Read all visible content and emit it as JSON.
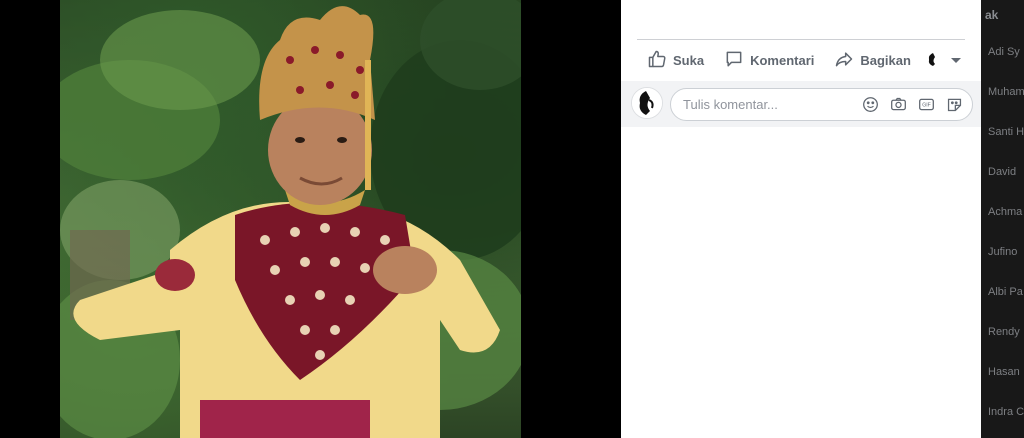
{
  "actions": {
    "like_label": "Suka",
    "comment_label": "Komentari",
    "share_label": "Bagikan"
  },
  "comment": {
    "placeholder": "Tulis komentar..."
  },
  "sidebar": {
    "heading": "ak",
    "contacts": [
      "Adi Sy",
      "Muham",
      "Santi H",
      "David",
      "Achma",
      "Jufino",
      "Albi Pa",
      "Rendy",
      "Hasan",
      "Indra C"
    ]
  },
  "icons": {
    "like": "thumbs-up-icon",
    "comment": "speech-bubble-icon",
    "share": "share-arrow-icon",
    "emoji": "smiley-icon",
    "camera": "camera-icon",
    "gif": "gif-icon",
    "sticker": "sticker-icon"
  },
  "colors": {
    "panel_bg": "#ffffff",
    "action_text": "#606770",
    "comment_bar_bg": "#f2f3f5",
    "sidebar_bg": "#181818"
  }
}
